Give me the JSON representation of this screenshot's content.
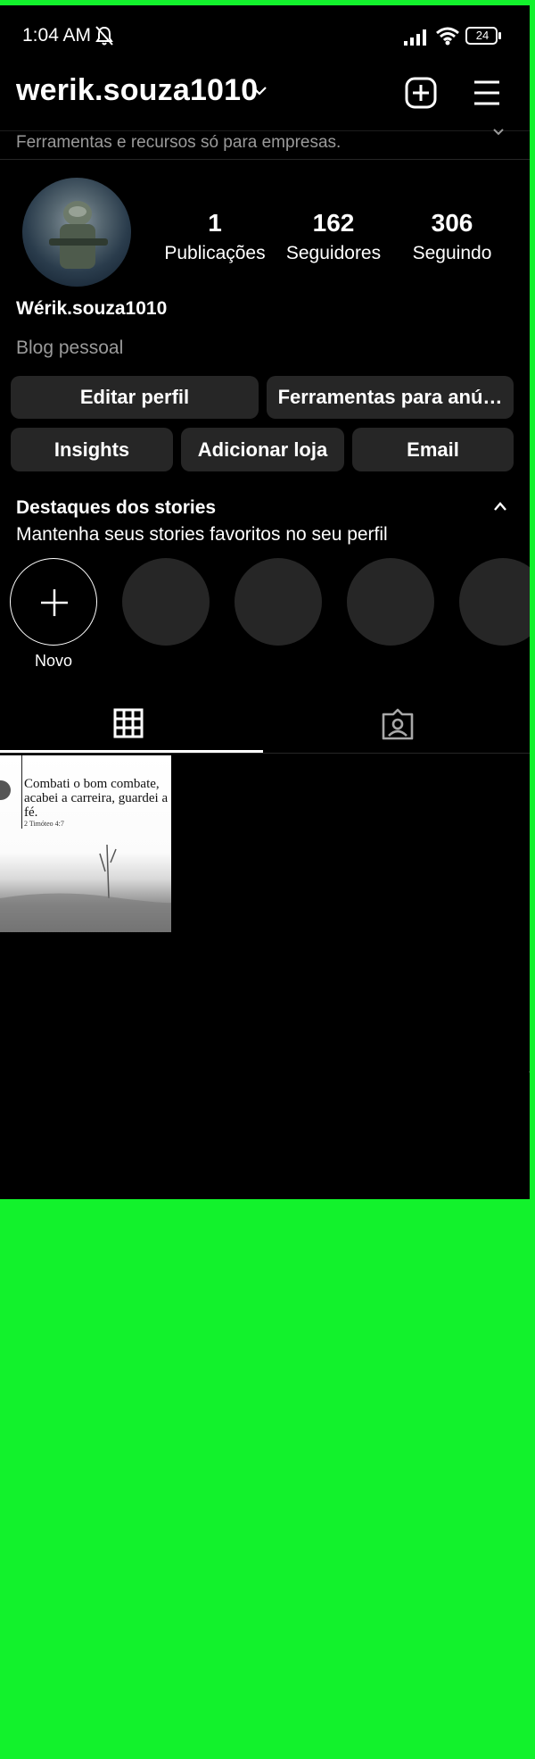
{
  "status_bar": {
    "time": "1:04 AM",
    "battery": "24"
  },
  "header": {
    "username": "werik.souza1010",
    "tools_banner": "Ferramentas e recursos só para empresas."
  },
  "profile": {
    "display_name": "Wérik.souza1010",
    "category": "Blog pessoal",
    "stats": [
      {
        "value": "1",
        "label": "Publicações"
      },
      {
        "value": "162",
        "label": "Seguidores"
      },
      {
        "value": "306",
        "label": "Seguindo"
      }
    ]
  },
  "buttons": {
    "edit_profile": "Editar perfil",
    "ad_tools": "Ferramentas para anú…",
    "insights": "Insights",
    "add_shop": "Adicionar loja",
    "email": "Email"
  },
  "highlights": {
    "title": "Destaques dos stories",
    "subtitle": "Mantenha seus stories favoritos no seu perfil",
    "new_label": "Novo"
  },
  "post": {
    "text": "Combati o bom combate, acabei a carreira, guardei a fé.",
    "reference": "2 Timóteo 4:7"
  },
  "colors": {
    "background": "#000000",
    "button": "#262626",
    "secondary_text": "#9a9a9a",
    "frame": "#12f22c"
  },
  "icons": [
    "bell-off-icon",
    "signal-icon",
    "wifi-icon",
    "battery-icon",
    "chevron-down-icon",
    "add-post-icon",
    "menu-icon",
    "chevron-up-icon",
    "plus-icon",
    "grid-icon",
    "tagged-icon"
  ]
}
